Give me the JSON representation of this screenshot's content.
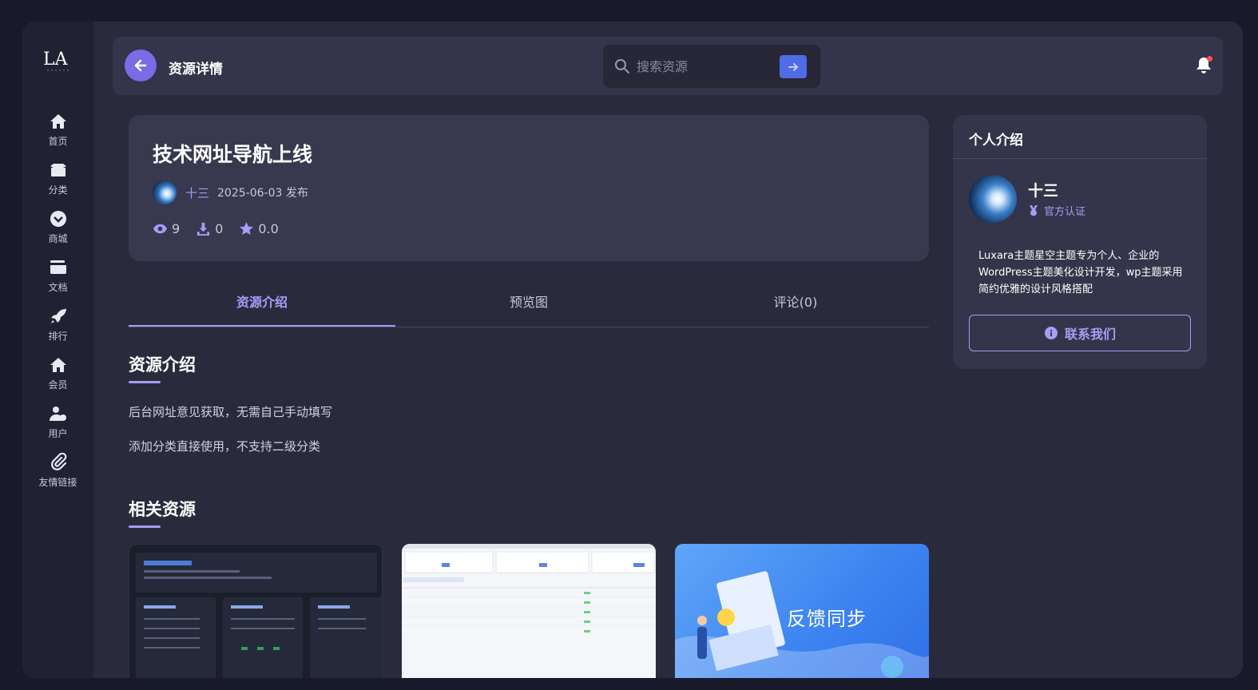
{
  "header": {
    "title": "资源详情",
    "search_placeholder": "搜索资源"
  },
  "sidebar": {
    "logo_text": "LA",
    "items": [
      {
        "label": "首页",
        "icon": "home-icon"
      },
      {
        "label": "分类",
        "icon": "box-icon"
      },
      {
        "label": "商城",
        "icon": "chevron-circle-icon"
      },
      {
        "label": "文档",
        "icon": "wallet-icon"
      },
      {
        "label": "排行",
        "icon": "rocket-icon"
      },
      {
        "label": "会员",
        "icon": "home-icon"
      },
      {
        "label": "用户",
        "icon": "user-icon"
      },
      {
        "label": "友情链接",
        "icon": "paperclip-icon"
      }
    ]
  },
  "article": {
    "title": "技术网址导航上线",
    "author": "十三",
    "date": "2025-06-03 发布",
    "views": "9",
    "downloads": "0",
    "rating": "0.0"
  },
  "tabs": [
    {
      "label": "资源介绍",
      "active": true
    },
    {
      "label": "预览图",
      "active": false
    },
    {
      "label": "评论(0)",
      "active": false
    }
  ],
  "intro": {
    "title": "资源介绍",
    "lines": [
      "后台网址意见获取，无需自己手动填写",
      "添加分类直接使用，不支持二级分类"
    ]
  },
  "related": {
    "title": "相关资源",
    "items": [
      {
        "caption": ""
      },
      {
        "caption": ""
      },
      {
        "caption": "反馈同步"
      }
    ]
  },
  "profile": {
    "title": "个人介绍",
    "name": "十三",
    "badge": "官方认证",
    "desc": "Luxara主题星空主题专为个人、企业的WordPress主题美化设计开发，wp主题采用简约优雅的设计风格搭配",
    "contact_label": "联系我们"
  },
  "colors": {
    "accent": "#a89cf5",
    "button": "#7c6ae6",
    "search_go": "#4f6ce4"
  }
}
